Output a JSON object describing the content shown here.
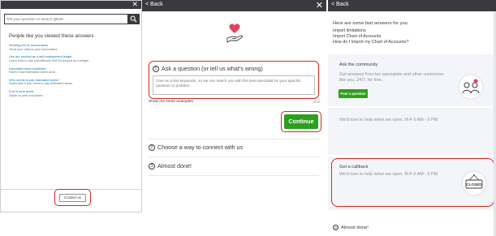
{
  "panel1": {
    "close_glyph": "✕",
    "search": {
      "placeholder": "Tell your question or search QBSE"
    },
    "heading": "People like you viewed these answers",
    "answers": [
      {
        "title": "Sending info to accountants",
        "subtitle": "Send your data to your accountant"
      },
      {
        "title": "Use our product as a self-employment ledger",
        "subtitle": "Learn how to use QuickBooks Self-Employed as a ledger"
      },
      {
        "title": "Estimated taxes explained",
        "subtitle": "Here's how estimated taxes work"
      },
      {
        "title": "Who needs to pay estimated taxes?",
        "subtitle": "Determine if you need to pay estimated taxes"
      },
      {
        "title": "End of year taxes",
        "subtitle": "Guide to year-end taxes"
      }
    ],
    "contact_label": "Contact us"
  },
  "panel2": {
    "back_label": "< Back",
    "close_glyph": "✕",
    "steps": [
      {
        "num": "1",
        "label": "Ask a question (or tell us what's wrong)"
      },
      {
        "num": "2",
        "label": "Choose a way to connect with us"
      },
      {
        "num": "3",
        "label": "Almost done!"
      }
    ],
    "textarea_placeholder": "Give us a few keywords, so we can match you with the best specialist for your specific question or problem.",
    "examples_label": "Show me some examples",
    "counter": "0/10",
    "continue_label": "Continue"
  },
  "panel3": {
    "back_label": "< Back",
    "intro": "Here are some fast answers for you",
    "links": [
      "Import limitations",
      "Import Chart of Accounts",
      "How do I import my Chart of Accounts?"
    ],
    "community": {
      "title": "Ask the community",
      "text_line1": "Get answers from tax specialists and other customers",
      "text_line2": "like you, 24/7, for free.",
      "button_label": "Post a question"
    },
    "hours_text": "We'd love to help when we open. M-F 6 AM - 6 PM",
    "callback": {
      "title": "Get a callback",
      "text": "We'd love to help when we open. M-F 6 AM - 6 PM",
      "icon_caption": "CLOSED"
    },
    "step3": {
      "num": "3",
      "label": "Almost done!"
    }
  },
  "colors": {
    "dark_bar": "#393a3d",
    "link_blue": "#0077c5",
    "green": "#2ca01c",
    "highlight_red": "#d52b1e"
  }
}
